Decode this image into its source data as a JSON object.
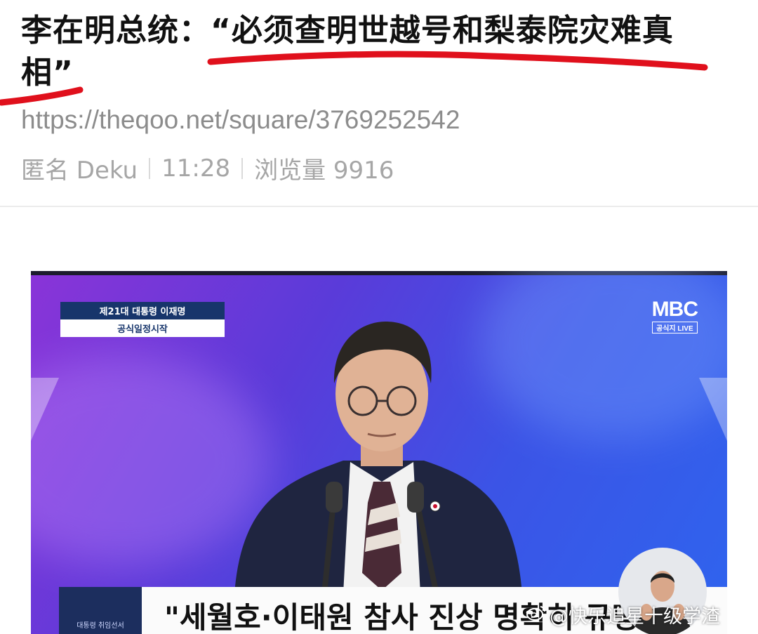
{
  "post": {
    "title_line1": "李在明总统：“必须查明世越号和梨泰院灾难真",
    "title_line2": "相”",
    "url": "https://theqoo.net/square/3769252542",
    "author": "匿名 Deku",
    "time": "11:28",
    "views": "浏览量 9916"
  },
  "broadcast": {
    "caption_line1": "제21대 대통령 이재명",
    "caption_line2": "공식일정시작",
    "logo_main": "MBC",
    "logo_sub": "공식지 LIVE",
    "ticker_thumb_text": "대통령 취임선서",
    "headline": "\"세월호·이태원 참사 진상 명확히 규명\""
  },
  "watermark": {
    "icon": "weibo-logo-icon",
    "text": "@快乐追星十级学渣"
  },
  "colors": {
    "underline": "#e0101c",
    "meta_text": "#a6a6a6",
    "broadcast_caption_bg": "#17356b"
  }
}
